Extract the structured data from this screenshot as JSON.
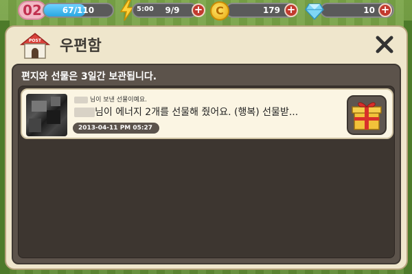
{
  "hud": {
    "level": "02",
    "exp_text": "67/110",
    "exp_fraction": 0.61,
    "energy_timer": "5:00",
    "energy_text": "9/9",
    "coins": "179",
    "gems": "10"
  },
  "mailbox": {
    "title": "우편함",
    "notice": "편지와 선물은 3일간 보관됩니다.",
    "icon_label": "POST",
    "items": [
      {
        "sender_suffix": "님이 보낸 선물이예요.",
        "message": "님이 에너지 2개를 선물해 줬어요. (행복) 선물받...",
        "date": "2013-04-11 PM 05:27"
      }
    ]
  },
  "colors": {
    "panel_bg": "#efe6cc",
    "inner_bg": "#5c534b",
    "exp_bar": "#2aa7e0",
    "plus_button": "#c23a2e"
  }
}
